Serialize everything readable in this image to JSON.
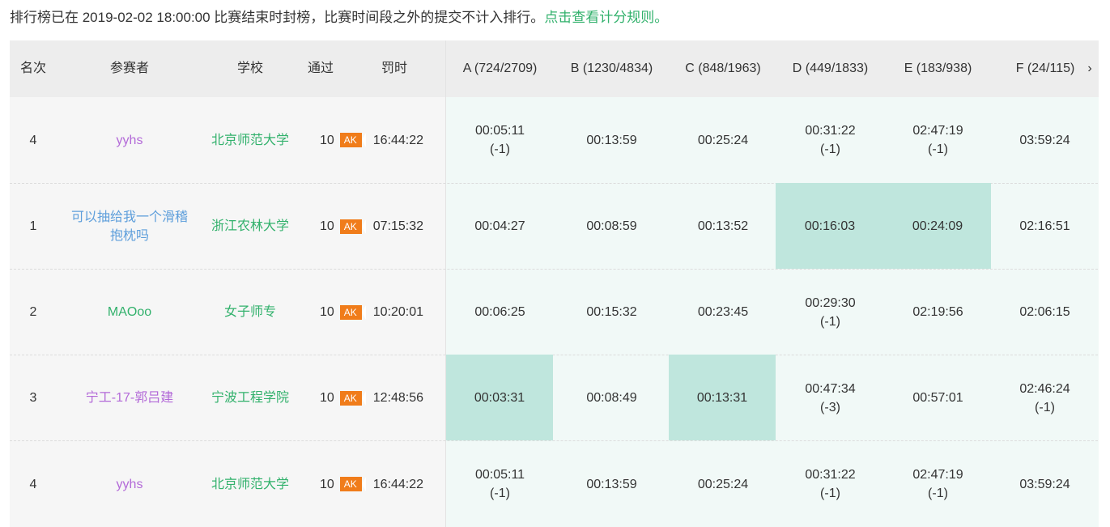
{
  "notice": {
    "text": "排行榜已在 2019-02-02 18:00:00 比赛结束时封榜，比赛时间段之外的提交不计入排行。",
    "link": "点击查看计分规则。"
  },
  "header": {
    "rank": "名次",
    "user": "参赛者",
    "school": "学校",
    "solved": "通过",
    "penalty": "罚时",
    "problems": [
      "A (724/2709)",
      "B (1230/4834)",
      "C (848/1963)",
      "D (449/1833)",
      "E (183/938)",
      "F (24/115)"
    ],
    "scroll_arrow": "›"
  },
  "rows": [
    {
      "rank": "4",
      "user": [
        "yyhs"
      ],
      "school": "北京师范大学",
      "solved": "10",
      "badge": "AK",
      "penalty": "16:44:22",
      "cells": [
        {
          "time": "00:05:11",
          "tries": "(-1)"
        },
        {
          "time": "00:13:59",
          "tries": ""
        },
        {
          "time": "00:25:24",
          "tries": ""
        },
        {
          "time": "00:31:22",
          "tries": "(-1)"
        },
        {
          "time": "02:47:19",
          "tries": "(-1)"
        },
        {
          "time": "03:59:24",
          "tries": ""
        }
      ]
    },
    {
      "rank": "1",
      "user": [
        "可以抽给我一个滑稽",
        "抱枕吗"
      ],
      "school": "浙江农林大学",
      "solved": "10",
      "badge": "AK",
      "penalty": "07:15:32",
      "cells": [
        {
          "time": "00:04:27",
          "tries": ""
        },
        {
          "time": "00:08:59",
          "tries": ""
        },
        {
          "time": "00:13:52",
          "tries": ""
        },
        {
          "time": "00:16:03",
          "tries": ""
        },
        {
          "time": "00:24:09",
          "tries": ""
        },
        {
          "time": "02:16:51",
          "tries": ""
        }
      ]
    },
    {
      "rank": "2",
      "user": [
        "MAOoo"
      ],
      "school": "女子师专",
      "solved": "10",
      "badge": "AK",
      "penalty": "10:20:01",
      "cells": [
        {
          "time": "00:06:25",
          "tries": ""
        },
        {
          "time": "00:15:32",
          "tries": ""
        },
        {
          "time": "00:23:45",
          "tries": ""
        },
        {
          "time": "00:29:30",
          "tries": "(-1)"
        },
        {
          "time": "02:19:56",
          "tries": ""
        },
        {
          "time": "02:06:15",
          "tries": ""
        }
      ]
    },
    {
      "rank": "3",
      "user": [
        "宁工-17-郭吕建"
      ],
      "school": "宁波工程学院",
      "solved": "10",
      "badge": "AK",
      "penalty": "12:48:56",
      "cells": [
        {
          "time": "00:03:31",
          "tries": ""
        },
        {
          "time": "00:08:49",
          "tries": ""
        },
        {
          "time": "00:13:31",
          "tries": ""
        },
        {
          "time": "00:47:34",
          "tries": "(-3)"
        },
        {
          "time": "00:57:01",
          "tries": ""
        },
        {
          "time": "02:46:24",
          "tries": "(-1)"
        }
      ]
    },
    {
      "rank": "4",
      "user": [
        "yyhs"
      ],
      "school": "北京师范大学",
      "solved": "10",
      "badge": "AK",
      "penalty": "16:44:22",
      "cells": [
        {
          "time": "00:05:11",
          "tries": "(-1)"
        },
        {
          "time": "00:13:59",
          "tries": ""
        },
        {
          "time": "00:25:24",
          "tries": ""
        },
        {
          "time": "00:31:22",
          "tries": "(-1)"
        },
        {
          "time": "02:47:19",
          "tries": "(-1)"
        },
        {
          "time": "03:59:24",
          "tries": ""
        }
      ]
    }
  ]
}
